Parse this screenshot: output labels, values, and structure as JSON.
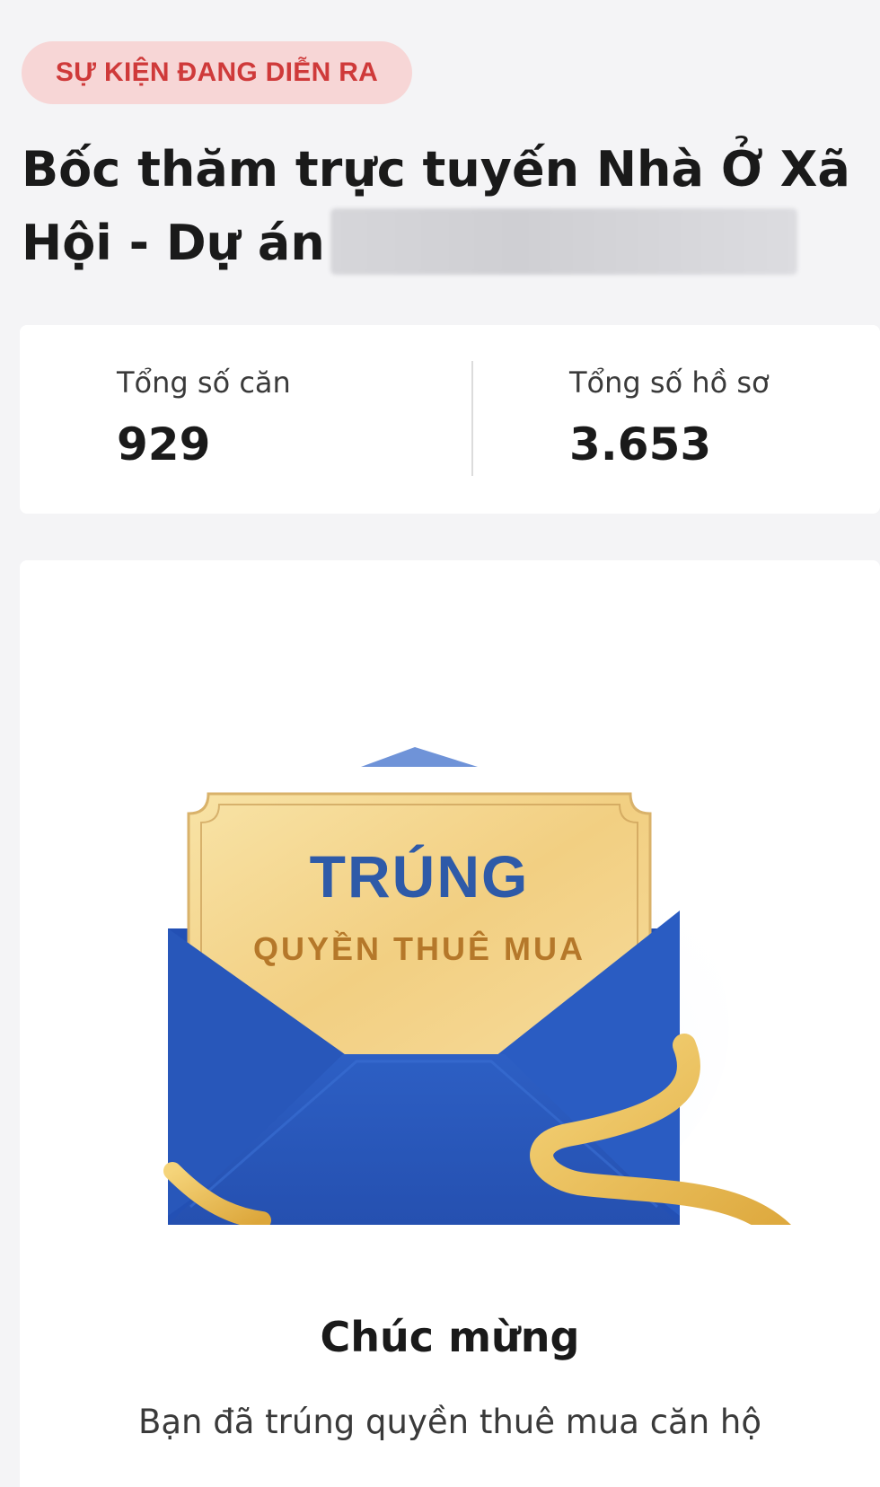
{
  "event_badge": {
    "label": "SỰ KIỆN ĐANG DIỄN RA"
  },
  "title": {
    "line1": "Bốc thăm trực tuyến Nhà Ở Xã",
    "line2": "Hội - Dự án"
  },
  "stats": [
    {
      "label": "Tổng số căn",
      "value": "929"
    },
    {
      "label": "Tổng số hồ sơ",
      "value": "3.653"
    }
  ],
  "result": {
    "ticket_title": "TRÚNG",
    "ticket_subtitle": "QUYỀN THUÊ MUA",
    "heading": "Chúc mừng",
    "message": "Bạn đã trúng quyền thuê mua căn hộ"
  },
  "colors": {
    "badge_bg": "#f7d6d6",
    "badge_text": "#cf3a3a",
    "envelope_blue": "#2f5fc0",
    "ticket_gold": "#f3d28a",
    "ribbon_gold": "#e9b84a"
  },
  "icons": [
    "envelope-illustration",
    "ribbon-decoration"
  ]
}
